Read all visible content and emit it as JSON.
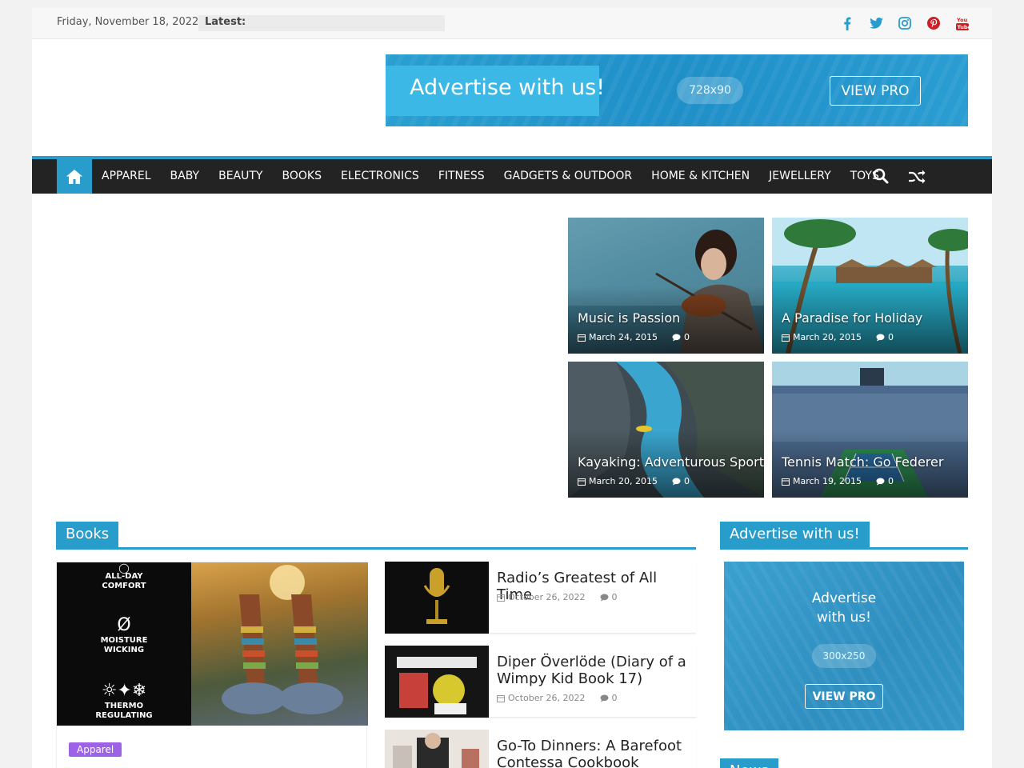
{
  "topbar": {
    "date": "Friday, November 18, 2022",
    "latest_label": "Latest:",
    "social_icons": [
      "facebook-icon",
      "twitter-icon",
      "instagram-icon",
      "pinterest-icon",
      "youtube-icon"
    ]
  },
  "header_ad": {
    "title": "Advertise with us!",
    "size": "728x90",
    "button": "VIEW PRO"
  },
  "nav": {
    "items": [
      "APPAREL",
      "BABY",
      "BEAUTY",
      "BOOKS",
      "ELECTRONICS",
      "FITNESS",
      "GADGETS & OUTDOOR",
      "HOME & KITCHEN",
      "JEWELLERY",
      "TOYS"
    ]
  },
  "featured": [
    {
      "title": "Music is Passion",
      "date": "March 24, 2015",
      "comments": "0"
    },
    {
      "title": "A Paradise for Holiday",
      "date": "March 20, 2015",
      "comments": "0"
    },
    {
      "title": "Kayaking: Adventurous Sport",
      "date": "March 20, 2015",
      "comments": "0"
    },
    {
      "title": "Tennis Match: Go Federer",
      "date": "March 19, 2015",
      "comments": "0"
    }
  ],
  "books_section": {
    "heading": "Books",
    "main": {
      "features": [
        "ALL-DAY COMFORT",
        "MOISTURE WICKING",
        "THERMO REGULATING"
      ],
      "badge": "Apparel"
    },
    "list": [
      {
        "title": "Radio’s Greatest of All Time",
        "date": "October 26, 2022",
        "comments": "0"
      },
      {
        "title": "Diper Överlöde (Diary of a Wimpy Kid Book 17)",
        "date": "October 26, 2022",
        "comments": "0"
      },
      {
        "title": "Go-To Dinners: A Barefoot Contessa Cookbook"
      }
    ]
  },
  "sidebar": {
    "ad_heading": "Advertise with us!",
    "ad": {
      "title_line1": "Advertise",
      "title_line2": "with us!",
      "size": "300x250",
      "button": "VIEW PRO"
    },
    "news_heading": "News"
  },
  "colors": {
    "accent": "#289dcc",
    "nav_bg": "#232323",
    "badge": "#9d62e6"
  }
}
